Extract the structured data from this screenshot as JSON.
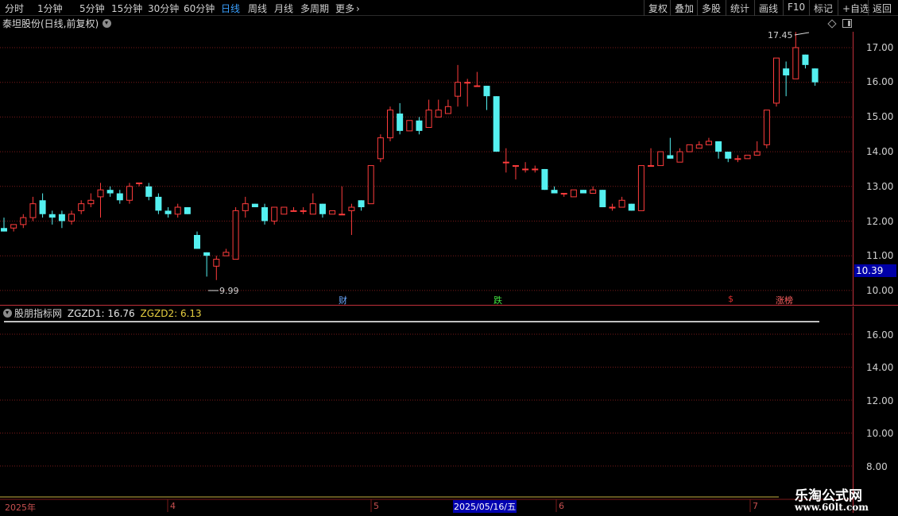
{
  "toolbar": {
    "periods": [
      "分时",
      "1分钟",
      "5分钟",
      "15分钟",
      "30分钟",
      "60分钟",
      "日线",
      "周线",
      "月线",
      "多周期",
      "更多"
    ],
    "active_period": "日线",
    "right_buttons": [
      "复权",
      "叠加",
      "多股",
      "统计",
      "画线",
      "F10",
      "标记",
      "+自选",
      "返回"
    ]
  },
  "main_chart": {
    "title": "泰坦股份(日线,前复权)",
    "y_ticks": [
      "17.00",
      "16.00",
      "15.00",
      "14.00",
      "13.00",
      "12.00",
      "11.00",
      "10.00"
    ],
    "current_price": "10.39",
    "high_label": "17.45",
    "low_label": "9.99",
    "event_flags": [
      {
        "label": "财",
        "color": "#6aa8ff"
      },
      {
        "label": "跌",
        "color": "#40e040"
      },
      {
        "label": "$",
        "color": "#e03030"
      },
      {
        "label": "涨榜",
        "color": "#ff6060"
      }
    ]
  },
  "indicator": {
    "name": "股朋指标网",
    "zgzd1": "ZGZD1: 16.76",
    "zgzd2": "ZGZD2: 6.13",
    "y_ticks": [
      "16.00",
      "14.00",
      "12.00",
      "10.00",
      "8.00"
    ]
  },
  "date_axis": {
    "labels": [
      "2025年",
      "4",
      "5",
      "6",
      "7"
    ],
    "cursor_date": "2025/05/16/五"
  },
  "watermark": {
    "line1": "乐淘公式网",
    "line2": "www.60lt.com"
  },
  "colors": {
    "up": "#ff3c3c",
    "down": "#54f0f0",
    "grid": "#7a1a1a",
    "axis": "#c0303a"
  },
  "chart_data": {
    "type": "candlestick",
    "ylim": [
      9.8,
      17.6
    ],
    "candles": [
      [
        11.8,
        11.7,
        12.1,
        11.7
      ],
      [
        11.8,
        11.9,
        11.9,
        11.7
      ],
      [
        11.9,
        12.1,
        12.2,
        11.8
      ],
      [
        12.1,
        12.5,
        12.7,
        12.0
      ],
      [
        12.6,
        12.2,
        12.8,
        12.1
      ],
      [
        12.2,
        12.1,
        12.3,
        11.9
      ],
      [
        12.2,
        12.0,
        12.3,
        11.8
      ],
      [
        12.0,
        12.2,
        12.3,
        11.9
      ],
      [
        12.3,
        12.5,
        12.6,
        12.2
      ],
      [
        12.5,
        12.6,
        12.8,
        12.4
      ],
      [
        12.7,
        12.9,
        13.1,
        12.1
      ],
      [
        12.9,
        12.8,
        13.0,
        12.7
      ],
      [
        12.8,
        12.6,
        12.9,
        12.5
      ],
      [
        12.6,
        13.0,
        13.1,
        12.5
      ],
      [
        13.1,
        13.1,
        13.1,
        13.0
      ],
      [
        13.0,
        12.7,
        13.1,
        12.6
      ],
      [
        12.7,
        12.3,
        12.8,
        12.2
      ],
      [
        12.3,
        12.2,
        12.4,
        12.1
      ],
      [
        12.2,
        12.4,
        12.5,
        12.1
      ],
      [
        12.4,
        12.2,
        12.4,
        12.2
      ],
      [
        11.6,
        11.2,
        11.7,
        11.2
      ],
      [
        11.1,
        11.0,
        11.1,
        10.4
      ],
      [
        10.7,
        10.9,
        11.0,
        10.3
      ],
      [
        11.0,
        11.1,
        11.2,
        11.0
      ],
      [
        10.9,
        12.3,
        12.4,
        10.9
      ],
      [
        12.3,
        12.5,
        12.7,
        12.1
      ],
      [
        12.5,
        12.4,
        12.5,
        12.4
      ],
      [
        12.4,
        12.0,
        12.5,
        11.9
      ],
      [
        12.0,
        12.4,
        12.4,
        11.9
      ],
      [
        12.2,
        12.4,
        12.4,
        12.2
      ],
      [
        12.3,
        12.3,
        12.4,
        12.3
      ],
      [
        12.3,
        12.3,
        12.4,
        12.2
      ],
      [
        12.2,
        12.5,
        12.8,
        12.2
      ],
      [
        12.5,
        12.2,
        12.5,
        12.1
      ],
      [
        12.2,
        12.3,
        12.3,
        12.2
      ],
      [
        12.2,
        12.2,
        13.0,
        12.2
      ],
      [
        12.3,
        12.4,
        12.5,
        11.6
      ],
      [
        12.6,
        12.4,
        12.6,
        12.3
      ],
      [
        12.5,
        13.6,
        13.6,
        12.5
      ],
      [
        13.8,
        14.4,
        14.5,
        13.7
      ],
      [
        14.4,
        15.2,
        15.3,
        14.3
      ],
      [
        15.1,
        14.6,
        15.4,
        14.5
      ],
      [
        14.6,
        14.9,
        14.9,
        14.6
      ],
      [
        14.9,
        14.6,
        15.0,
        14.5
      ],
      [
        14.7,
        15.2,
        15.5,
        14.7
      ],
      [
        15.0,
        15.2,
        15.5,
        15.0
      ],
      [
        15.1,
        15.3,
        15.5,
        15.1
      ],
      [
        15.6,
        16.0,
        16.5,
        15.3
      ],
      [
        16.0,
        16.0,
        16.1,
        15.3
      ],
      [
        15.9,
        15.9,
        16.3,
        15.9
      ],
      [
        15.9,
        15.6,
        15.9,
        15.2
      ],
      [
        15.6,
        14.0,
        15.6,
        14.0
      ],
      [
        13.7,
        13.7,
        14.1,
        13.4
      ],
      [
        13.6,
        13.6,
        13.6,
        13.2
      ],
      [
        13.5,
        13.5,
        13.7,
        13.4
      ],
      [
        13.5,
        13.5,
        13.6,
        13.4
      ],
      [
        13.5,
        12.9,
        13.5,
        12.9
      ],
      [
        12.9,
        12.8,
        13.0,
        12.8
      ],
      [
        12.8,
        12.8,
        12.8,
        12.7
      ],
      [
        12.7,
        12.9,
        12.9,
        12.7
      ],
      [
        12.9,
        12.8,
        12.9,
        12.8
      ],
      [
        12.8,
        12.9,
        13.0,
        12.8
      ],
      [
        12.9,
        12.4,
        12.9,
        12.4
      ],
      [
        12.4,
        12.4,
        12.5,
        12.3
      ],
      [
        12.4,
        12.6,
        12.7,
        12.4
      ],
      [
        12.5,
        12.3,
        12.5,
        12.3
      ],
      [
        12.3,
        13.6,
        13.6,
        12.3
      ],
      [
        13.6,
        13.6,
        14.1,
        13.6
      ],
      [
        13.6,
        14.0,
        14.0,
        13.6
      ],
      [
        13.9,
        13.8,
        14.4,
        13.8
      ],
      [
        13.7,
        14.0,
        14.1,
        13.7
      ],
      [
        14.0,
        14.2,
        14.2,
        14.0
      ],
      [
        14.1,
        14.2,
        14.3,
        14.1
      ],
      [
        14.2,
        14.3,
        14.4,
        14.2
      ],
      [
        14.3,
        14.0,
        14.3,
        13.8
      ],
      [
        14.0,
        13.8,
        14.0,
        13.7
      ],
      [
        13.8,
        13.8,
        13.9,
        13.7
      ],
      [
        13.8,
        13.9,
        13.9,
        13.8
      ],
      [
        13.9,
        14.0,
        14.3,
        13.9
      ],
      [
        14.2,
        15.2,
        15.2,
        14.1
      ],
      [
        15.4,
        16.7,
        16.7,
        15.3
      ],
      [
        16.4,
        16.2,
        16.6,
        15.6
      ],
      [
        16.1,
        17.0,
        17.45,
        16.1
      ],
      [
        16.8,
        16.5,
        16.8,
        16.4
      ],
      [
        16.4,
        16.0,
        16.4,
        15.9
      ]
    ],
    "indicator_line": 16.76
  }
}
